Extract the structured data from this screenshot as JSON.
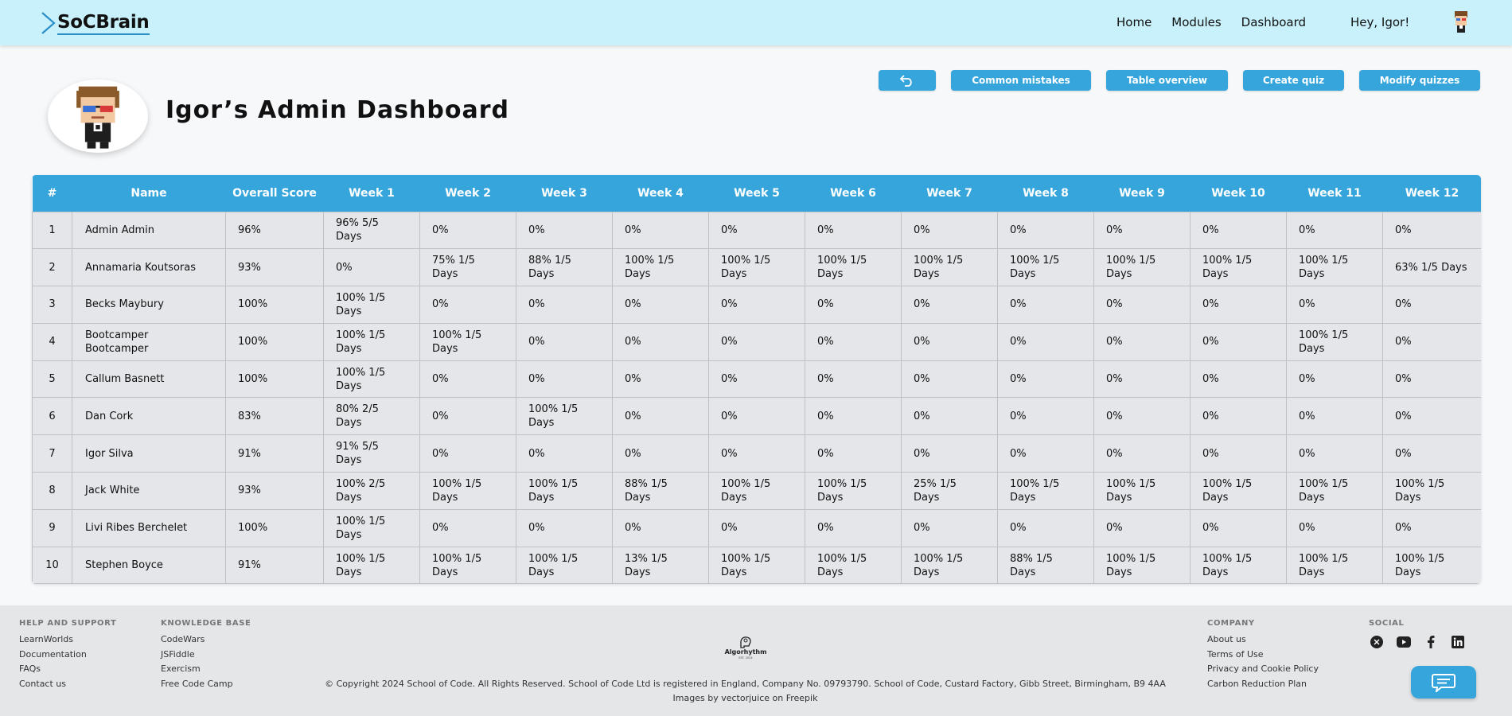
{
  "header": {
    "logo_text": "SoCBrain",
    "nav": [
      "Home",
      "Modules",
      "Dashboard"
    ],
    "greeting": "Hey, Igor!"
  },
  "page": {
    "title": "Igor’s Admin Dashboard"
  },
  "actions": {
    "back_icon": "undo-arrow-icon",
    "buttons": [
      "Common mistakes",
      "Table overview",
      "Create quiz",
      "Modify quizzes"
    ]
  },
  "table": {
    "headers": [
      "#",
      "Name",
      "Overall Score",
      "Week 1",
      "Week 2",
      "Week 3",
      "Week 4",
      "Week 5",
      "Week 6",
      "Week 7",
      "Week 8",
      "Week 9",
      "Week 10",
      "Week 11",
      "Week 12"
    ],
    "rows": [
      [
        "1",
        "Admin Admin",
        "96%",
        "96% 5/5 Days",
        "0%",
        "0%",
        "0%",
        "0%",
        "0%",
        "0%",
        "0%",
        "0%",
        "0%",
        "0%",
        "0%"
      ],
      [
        "2",
        "Annamaria Koutsoras",
        "93%",
        "0%",
        "75% 1/5 Days",
        "88% 1/5 Days",
        "100% 1/5 Days",
        "100% 1/5 Days",
        "100% 1/5 Days",
        "100% 1/5 Days",
        "100% 1/5 Days",
        "100% 1/5 Days",
        "100% 1/5 Days",
        "100% 1/5 Days",
        "63% 1/5 Days"
      ],
      [
        "3",
        "Becks Maybury",
        "100%",
        "100% 1/5 Days",
        "0%",
        "0%",
        "0%",
        "0%",
        "0%",
        "0%",
        "0%",
        "0%",
        "0%",
        "0%",
        "0%"
      ],
      [
        "4",
        "Bootcamper Bootcamper",
        "100%",
        "100% 1/5 Days",
        "100% 1/5 Days",
        "0%",
        "0%",
        "0%",
        "0%",
        "0%",
        "0%",
        "0%",
        "0%",
        "100% 1/5 Days",
        "0%"
      ],
      [
        "5",
        "Callum Basnett",
        "100%",
        "100% 1/5 Days",
        "0%",
        "0%",
        "0%",
        "0%",
        "0%",
        "0%",
        "0%",
        "0%",
        "0%",
        "0%",
        "0%"
      ],
      [
        "6",
        "Dan Cork",
        "83%",
        "80% 2/5 Days",
        "0%",
        "100% 1/5 Days",
        "0%",
        "0%",
        "0%",
        "0%",
        "0%",
        "0%",
        "0%",
        "0%",
        "0%"
      ],
      [
        "7",
        "Igor Silva",
        "91%",
        "91% 5/5 Days",
        "0%",
        "0%",
        "0%",
        "0%",
        "0%",
        "0%",
        "0%",
        "0%",
        "0%",
        "0%",
        "0%"
      ],
      [
        "8",
        "Jack White",
        "93%",
        "100% 2/5 Days",
        "100% 1/5 Days",
        "100% 1/5 Days",
        "88% 1/5 Days",
        "100% 1/5 Days",
        "100% 1/5 Days",
        "25% 1/5 Days",
        "100% 1/5 Days",
        "100% 1/5 Days",
        "100% 1/5 Days",
        "100% 1/5 Days",
        "100% 1/5 Days"
      ],
      [
        "9",
        "Livi Ribes Berchelet",
        "100%",
        "100% 1/5 Days",
        "0%",
        "0%",
        "0%",
        "0%",
        "0%",
        "0%",
        "0%",
        "0%",
        "0%",
        "0%",
        "0%"
      ],
      [
        "10",
        "Stephen Boyce",
        "91%",
        "100% 1/5 Days",
        "100% 1/5 Days",
        "100% 1/5 Days",
        "13% 1/5 Days",
        "100% 1/5 Days",
        "100% 1/5 Days",
        "100% 1/5 Days",
        "88% 1/5 Days",
        "100% 1/5 Days",
        "100% 1/5 Days",
        "100% 1/5 Days",
        "100% 1/5 Days"
      ]
    ]
  },
  "footer": {
    "help": {
      "heading": "HELP AND SUPPORT",
      "links": [
        "LearnWorlds",
        "Documentation",
        "FAQs",
        "Contact us"
      ]
    },
    "knowledge": {
      "heading": "KNOWLEDGE BASE",
      "links": [
        "CodeWars",
        "JSFiddle",
        "Exercism",
        "Free Code Camp"
      ]
    },
    "brand": {
      "name": "Algorhythm",
      "tagline": "EST. 2024"
    },
    "copyright": "© Copyright 2024 School of Code. All Rights Reserved. School of Code Ltd is registered in England, Company No. 09793790. School of Code, Custard Factory, Gibb Street, Birmingham, B9 4AA",
    "credit": "Images by vectorjuice on Freepik",
    "company": {
      "heading": "COMPANY",
      "links": [
        "About us",
        "Terms of Use",
        "Privacy and Cookie Policy",
        "Carbon Reduction Plan"
      ]
    },
    "social": {
      "heading": "SOCIAL",
      "icons": [
        "x-icon",
        "youtube-icon",
        "facebook-icon",
        "linkedin-icon"
      ]
    }
  },
  "chat": {
    "icon": "chat-bubble-icon"
  },
  "colors": {
    "accent": "#35a5dc",
    "header_bg": "#c8f1fb",
    "footer_bg": "#e5e6e8"
  }
}
